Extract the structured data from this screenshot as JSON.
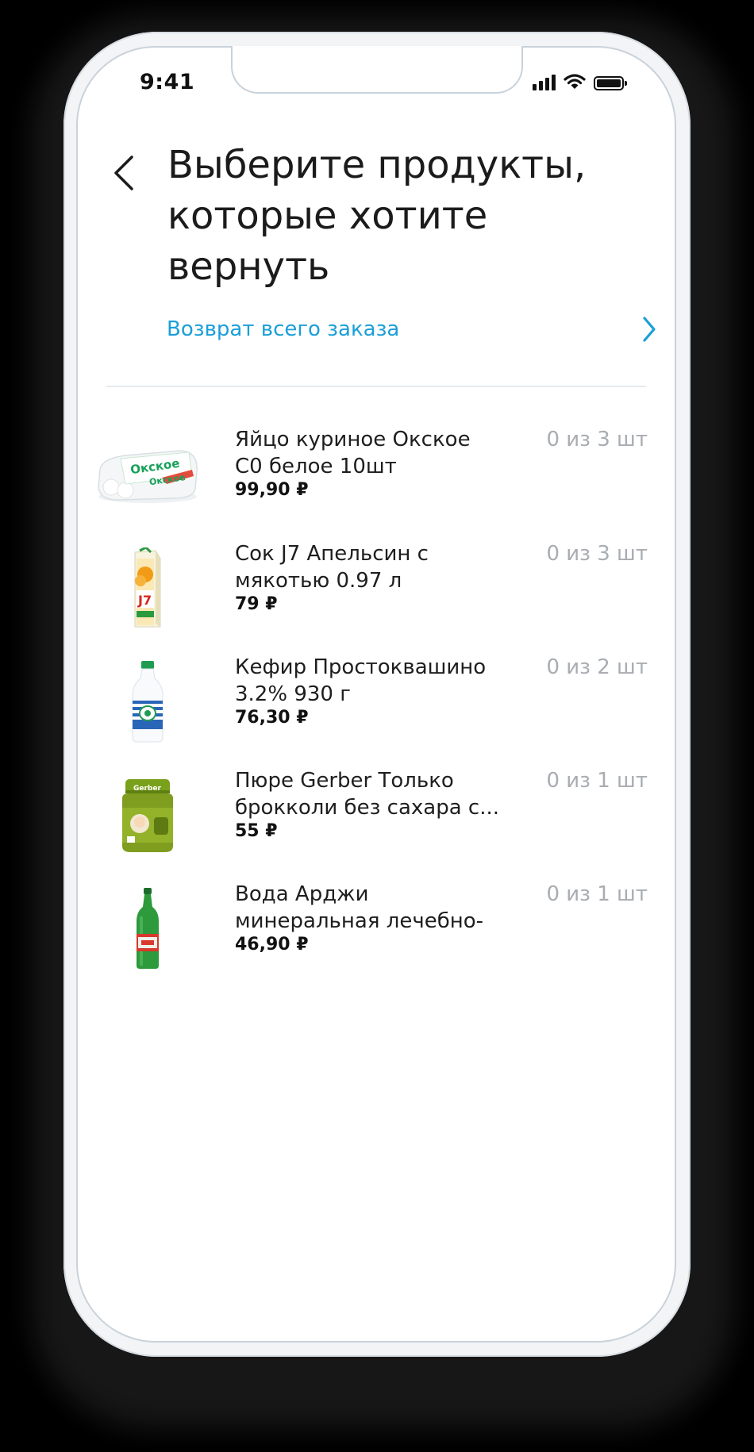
{
  "status_bar": {
    "time": "9:41"
  },
  "header": {
    "title_lines": [
      "Выберите продукты,",
      "которые хотите",
      "вернуть"
    ]
  },
  "return_all": {
    "label": "Возврат всего заказа"
  },
  "products": [
    {
      "name_lines": [
        "Яйцо куриное Окское",
        "С0 белое 10шт"
      ],
      "price": "99,90 ₽",
      "qty": "0 из 3 шт"
    },
    {
      "name_lines": [
        "Сок J7 Апельсин с",
        "мякотью 0.97 л"
      ],
      "price": "79 ₽",
      "qty": "0 из 3 шт"
    },
    {
      "name_lines": [
        "Кефир Простоквашино",
        "3.2% 930 г"
      ],
      "price": "76,30 ₽",
      "qty": "0 из 2 шт"
    },
    {
      "name_lines": [
        "Пюре Gerber Только",
        "брокколи без сахара с..."
      ],
      "price": "55 ₽",
      "qty": "0 из 1 шт"
    },
    {
      "name_lines": [
        "Вода Арджи",
        "минеральная лечебно-"
      ],
      "price": "46,90 ₽",
      "qty": "0 из 1 шт"
    }
  ],
  "colors": {
    "accent": "#1a9fd8",
    "muted": "#a9adb2"
  }
}
